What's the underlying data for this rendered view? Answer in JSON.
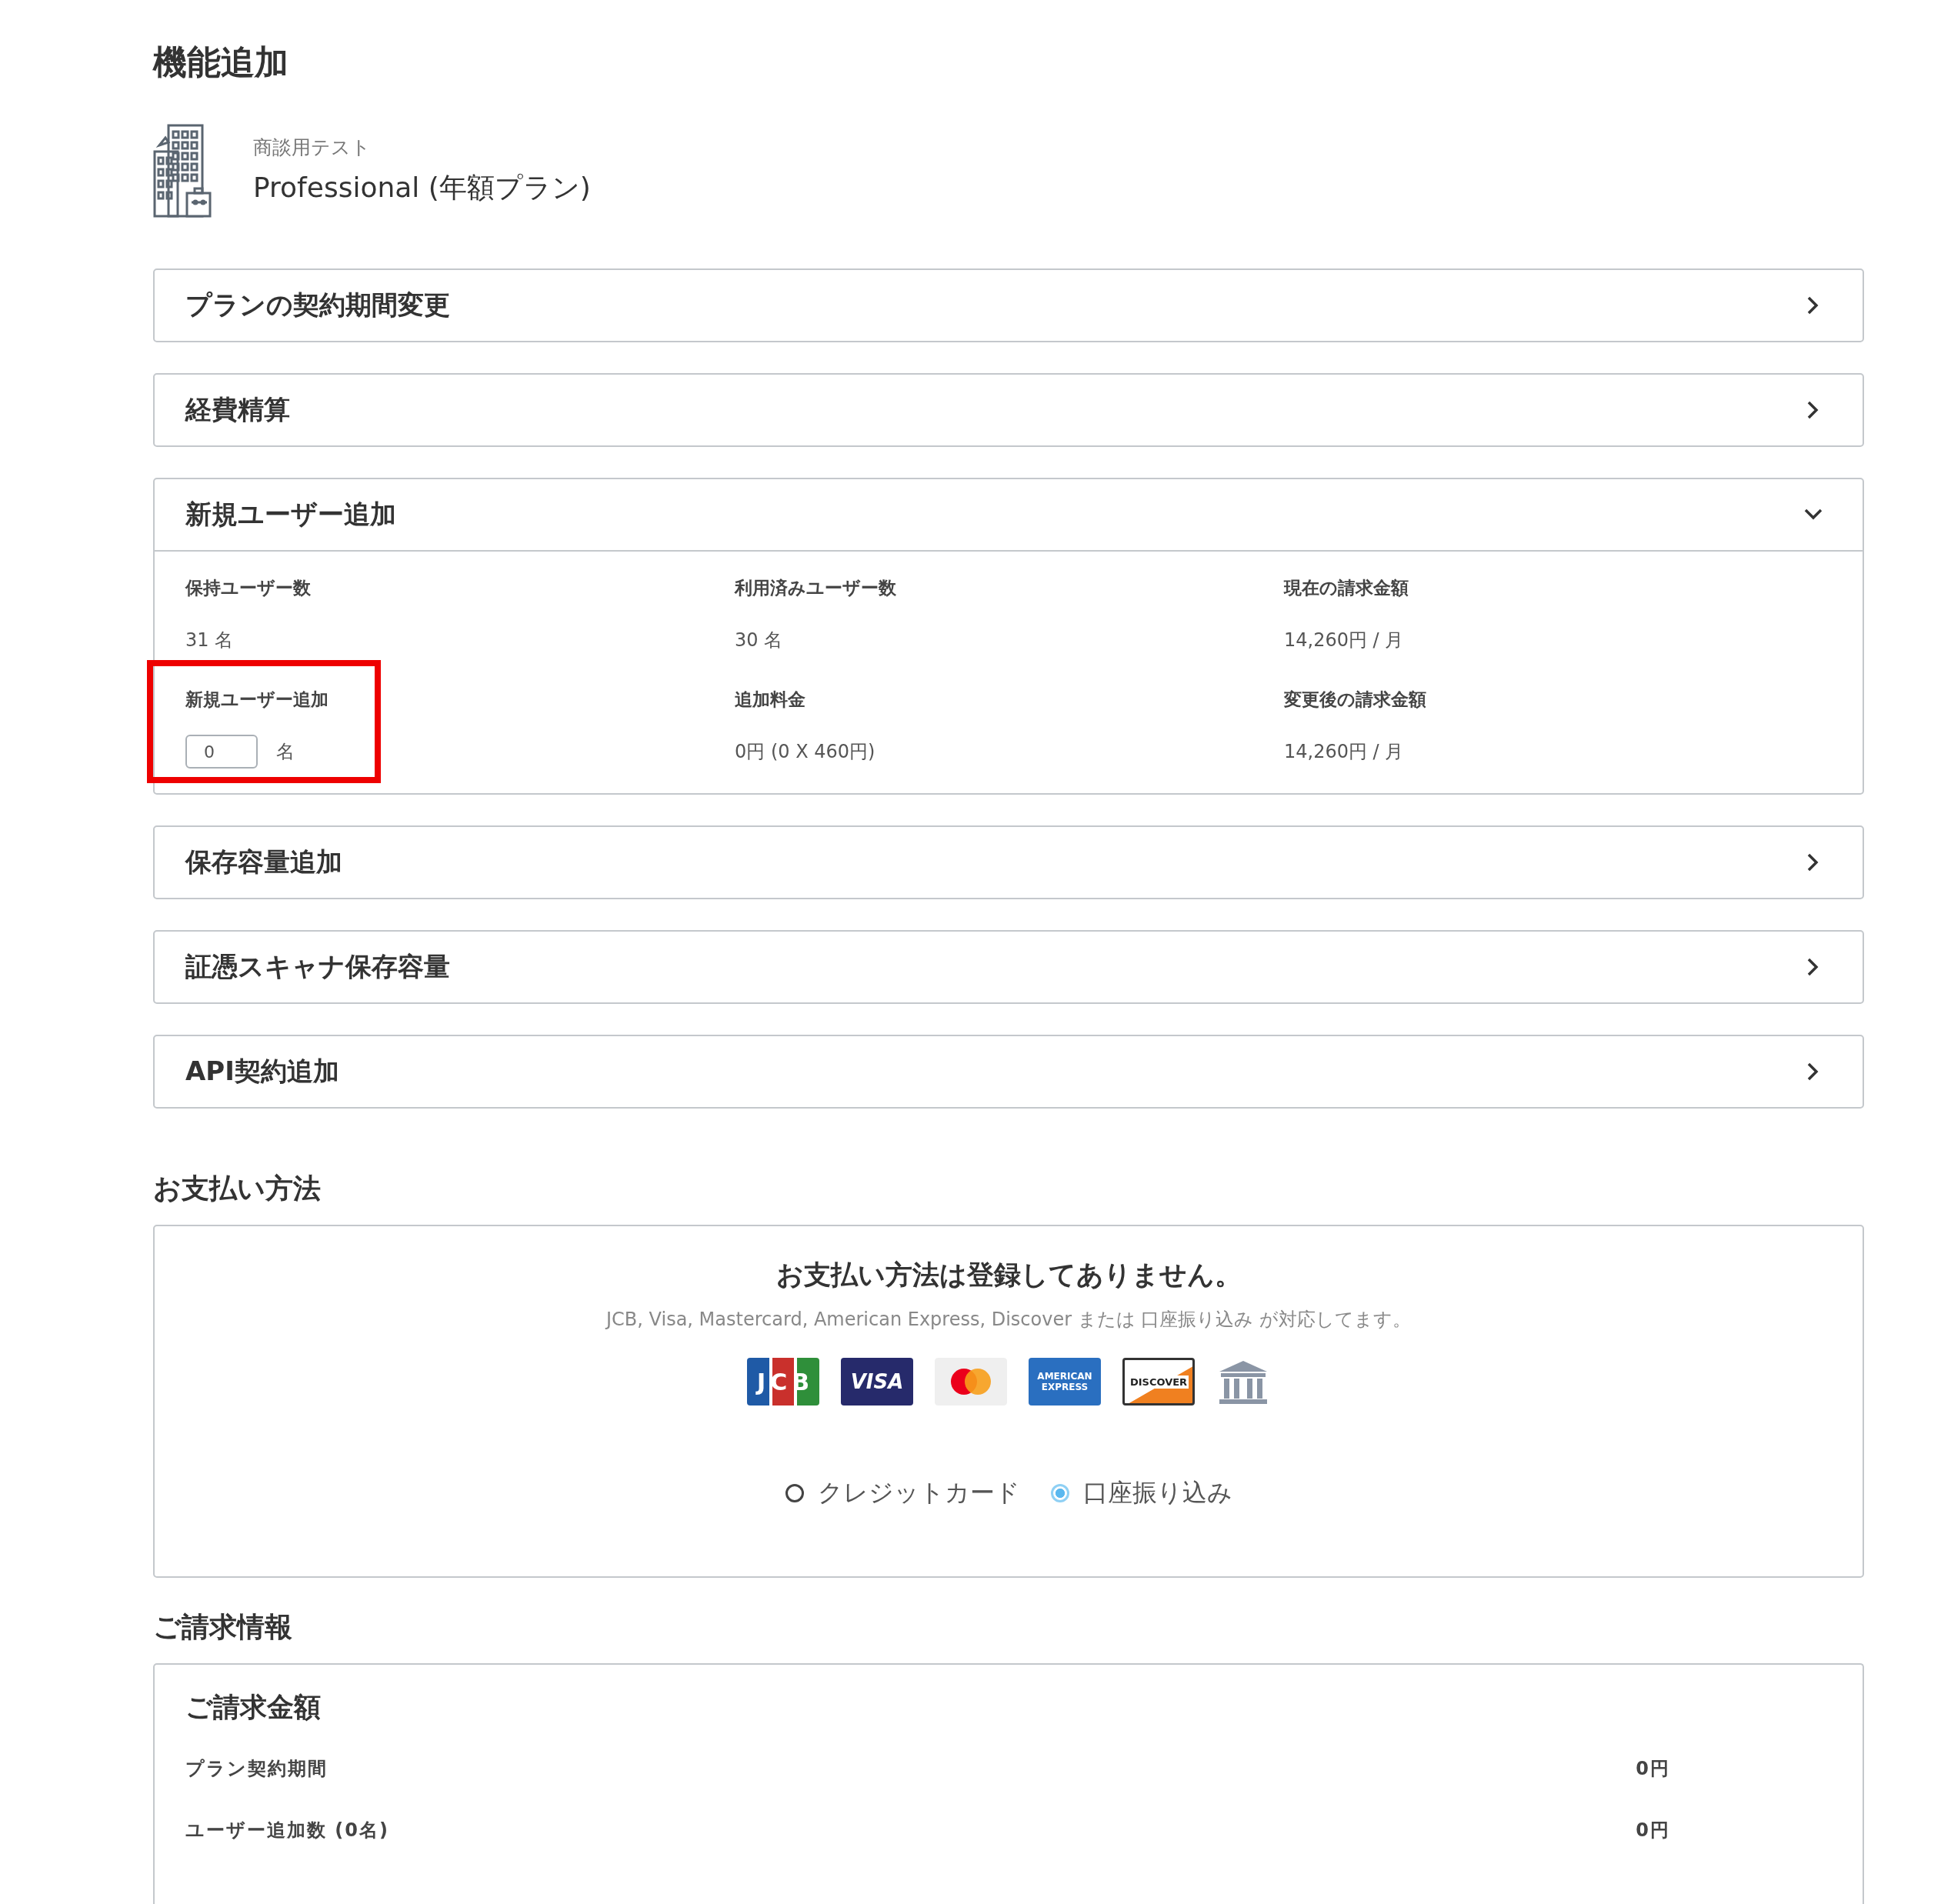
{
  "page_title": "機能追加",
  "plan": {
    "company": "商談用テスト",
    "name": "Professional (年額プラン)"
  },
  "sections": [
    {
      "title": "プランの契約期間変更",
      "expanded": false
    },
    {
      "title": "経費精算",
      "expanded": false
    },
    {
      "title": "新規ユーザー追加",
      "expanded": true,
      "fields": [
        {
          "kind": "text",
          "label": "保持ユーザー数",
          "value": "31 名"
        },
        {
          "kind": "text",
          "label": "利用済みユーザー数",
          "value": "30 名"
        },
        {
          "kind": "text",
          "label": "現在の請求金額",
          "value": "14,260円 / 月"
        },
        {
          "kind": "input",
          "label": "新規ユーザー追加",
          "value": "0",
          "unit": "名",
          "highlighted": true
        },
        {
          "kind": "text",
          "label": "追加料金",
          "value": "0円 (0 X 460円)"
        },
        {
          "kind": "text",
          "label": "変更後の請求金額",
          "value": "14,260円 / 月"
        }
      ]
    },
    {
      "title": "保存容量追加",
      "expanded": false
    },
    {
      "title": "証憑スキャナ保存容量",
      "expanded": false
    },
    {
      "title": "API契約追加",
      "expanded": false
    }
  ],
  "payment": {
    "heading": "お支払い方法",
    "message": "お支払い方法は登録してありません。",
    "note": "JCB, Visa, Mastercard, American Express, Discover または 口座振り込み が対応してます。",
    "brands": [
      {
        "kind": "jcb",
        "label": "JCB"
      },
      {
        "kind": "visa",
        "label": "VISA"
      },
      {
        "kind": "mastercard"
      },
      {
        "kind": "amex",
        "label": "AMERICAN EXPRESS"
      },
      {
        "kind": "discover",
        "label": "DISCOVER"
      },
      {
        "kind": "bank"
      }
    ],
    "methods": [
      {
        "label": "クレジットカード",
        "selected": false
      },
      {
        "label": "口座振り込み",
        "selected": true
      }
    ]
  },
  "billing": {
    "heading": "ご請求情報",
    "card_title": "ご請求金額",
    "rows": [
      {
        "label": "プラン契約期間",
        "amount": "0円"
      },
      {
        "label": "ユーザー追加数 (0名)",
        "amount": "0円"
      }
    ]
  }
}
